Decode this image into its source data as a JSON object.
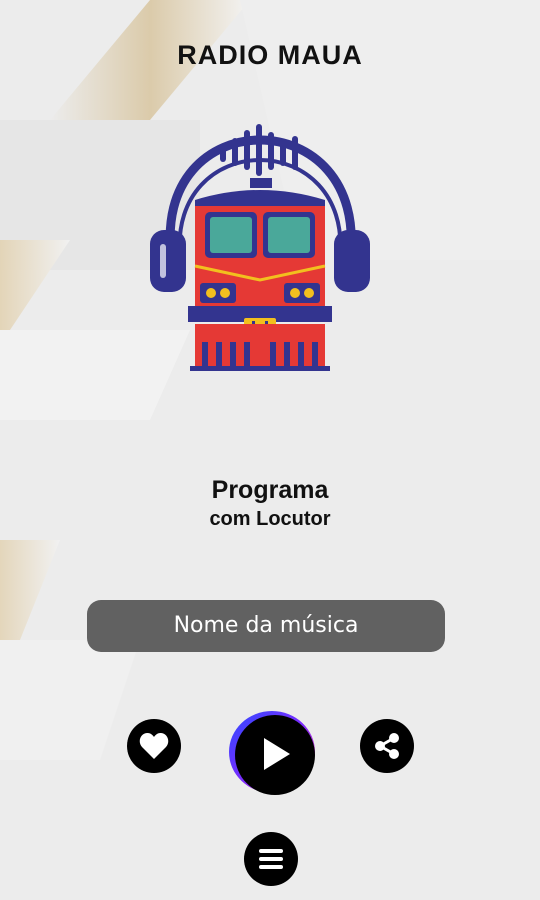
{
  "app": {
    "title": "RADIO MAUA"
  },
  "program": {
    "name": "Programa",
    "host": "com Locutor"
  },
  "song": {
    "title": "Nome da música"
  },
  "controls": {
    "favorite_icon": "heart-icon",
    "play_icon": "play-icon",
    "share_icon": "share-icon",
    "menu_icon": "menu-icon"
  },
  "colors": {
    "background": "#ececec",
    "song_bar": "#616161",
    "train_red": "#e53935",
    "train_navy": "#33348f",
    "window_teal": "#4aa89a",
    "light_yellow": "#f2c01e",
    "play_gradient": [
      "#ff2fa0",
      "#7a2bff",
      "#2f4bff"
    ]
  }
}
